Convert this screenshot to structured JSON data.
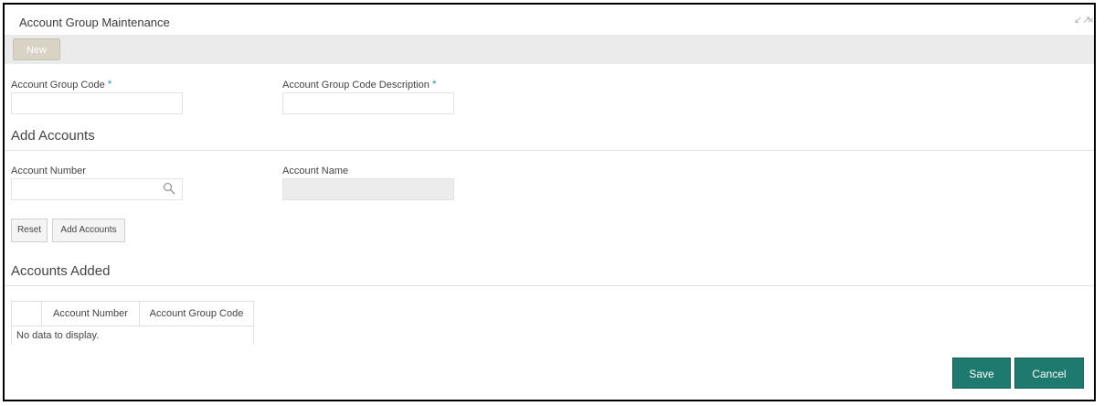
{
  "window": {
    "title": "Account Group Maintenance",
    "minimize_glyph": "↙↗",
    "close_glyph": "×"
  },
  "toolbar": {
    "new_label": "New"
  },
  "form": {
    "account_group_code_label": "Account Group Code",
    "account_group_code_required": "*",
    "account_group_code_value": "",
    "account_group_desc_label": "Account Group Code Description",
    "account_group_desc_required": "*",
    "account_group_desc_value": ""
  },
  "add_accounts": {
    "heading": "Add Accounts",
    "account_number_label": "Account Number",
    "account_number_value": "",
    "account_name_label": "Account Name",
    "account_name_value": "",
    "reset_label": "Reset",
    "add_accounts_label": "Add Accounts"
  },
  "accounts_added": {
    "heading": "Accounts Added",
    "columns": [
      "",
      "Account Number",
      "Account Group Code"
    ],
    "empty_message": "No data to display."
  },
  "actions": {
    "save_label": "Save",
    "cancel_label": "Cancel"
  },
  "colors": {
    "accent": "#1e7a6e",
    "required": "#2a9d8f",
    "toolbar_bg": "#ebebeb"
  },
  "icons": {
    "search": "search-icon",
    "expand": "expand-icon",
    "close": "close-icon"
  }
}
